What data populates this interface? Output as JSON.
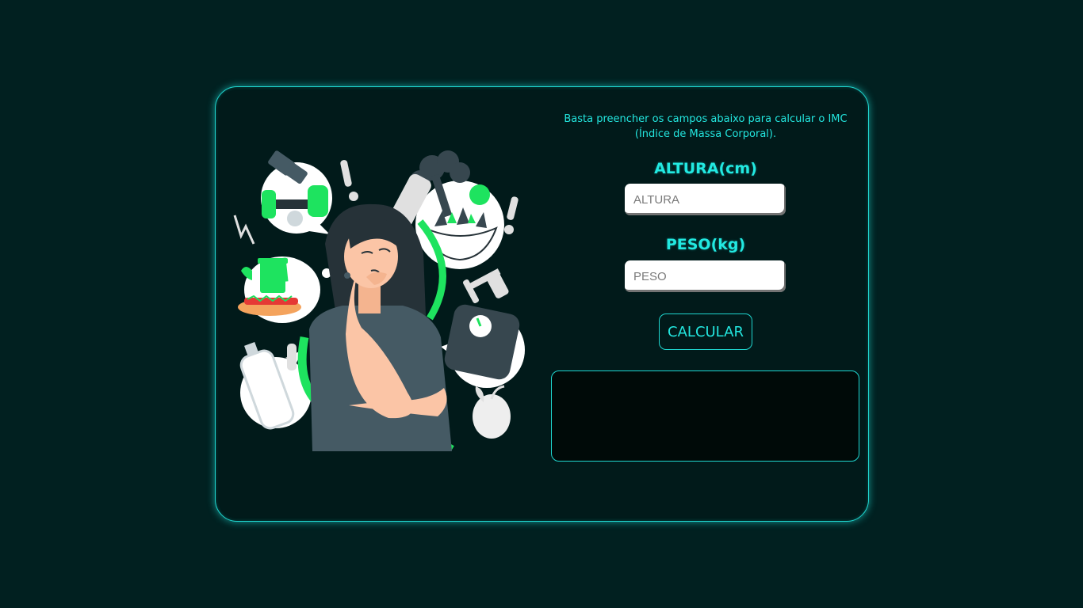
{
  "intro_text": "Basta preencher os campos abaixo para calcular o IMC (Índice de Massa Corporal).",
  "altura": {
    "label": "ALTURA(cm)",
    "placeholder": "ALTURA",
    "value": ""
  },
  "peso": {
    "label": "PESO(kg)",
    "placeholder": "PESO",
    "value": ""
  },
  "calculate_label": "CALCULAR",
  "result_text": "",
  "colors": {
    "accent": "#1fd6cf",
    "background": "#012020",
    "highlight_green": "#1ee35f"
  },
  "illustration_icons": [
    "dumbbell-icon",
    "salad-bowl-icon",
    "fast-food-icon",
    "water-bottle-icon",
    "bathroom-scale-icon",
    "apple-icon",
    "measuring-tape-icon",
    "exclamation-icon",
    "lightning-icon"
  ]
}
